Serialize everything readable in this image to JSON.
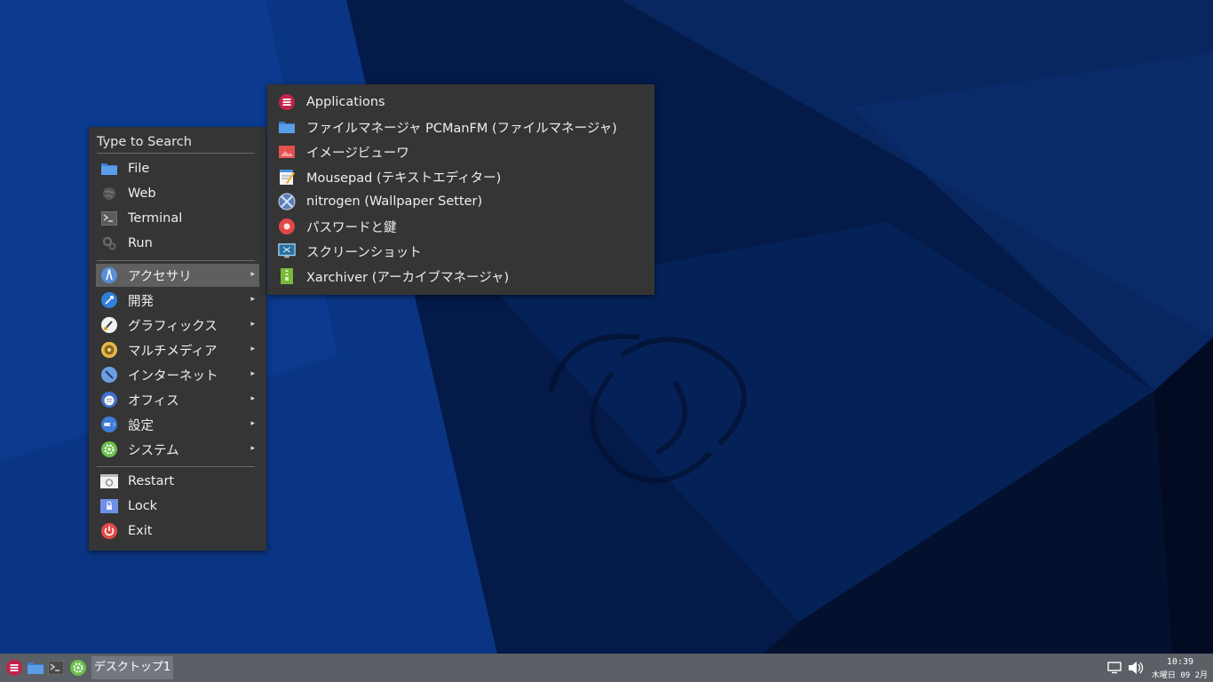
{
  "colors": {
    "menu_bg": "#353535",
    "menu_highlight": "#5f5f5f",
    "taskbar_bg": "#5b5f66",
    "desktop_bg": "#061a3f",
    "app_icon_red": "#c0234b",
    "folder_blue": "#4a8fdb"
  },
  "main_menu": {
    "search_placeholder": "Type to Search",
    "places": [
      {
        "label": "File",
        "icon": "folder-icon"
      },
      {
        "label": "Web",
        "icon": "globe-icon"
      },
      {
        "label": "Terminal",
        "icon": "terminal-icon"
      },
      {
        "label": "Run",
        "icon": "gears-icon"
      }
    ],
    "categories": [
      {
        "label": "アクセサリ",
        "icon": "accessories-icon",
        "active": true
      },
      {
        "label": "開発",
        "icon": "development-icon"
      },
      {
        "label": "グラフィックス",
        "icon": "graphics-icon"
      },
      {
        "label": "マルチメディア",
        "icon": "multimedia-icon"
      },
      {
        "label": "インターネット",
        "icon": "internet-icon"
      },
      {
        "label": "オフィス",
        "icon": "office-icon"
      },
      {
        "label": "設定",
        "icon": "settings-icon"
      },
      {
        "label": "システム",
        "icon": "system-icon"
      }
    ],
    "session": [
      {
        "label": "Restart",
        "icon": "restart-icon"
      },
      {
        "label": "Lock",
        "icon": "lock-icon"
      },
      {
        "label": "Exit",
        "icon": "power-icon"
      }
    ]
  },
  "sub_menu": {
    "items": [
      {
        "label": "Applications",
        "icon": "applications-icon"
      },
      {
        "label": "ファイルマネージャ PCManFM (ファイルマネージャ)",
        "icon": "folder-icon"
      },
      {
        "label": "イメージビューワ",
        "icon": "image-viewer-icon"
      },
      {
        "label": "Mousepad (テキストエディター)",
        "icon": "text-editor-icon"
      },
      {
        "label": "nitrogen (Wallpaper Setter)",
        "icon": "nitrogen-icon"
      },
      {
        "label": "パスワードと鍵",
        "icon": "password-keys-icon"
      },
      {
        "label": "スクリーンショット",
        "icon": "screenshot-icon"
      },
      {
        "label": "Xarchiver (アーカイブマネージャ)",
        "icon": "archive-icon"
      }
    ]
  },
  "taskbar": {
    "desktop_label": "デスクトップ1",
    "clock_time": "10:39",
    "clock_date": "木曜日 09 2月"
  }
}
